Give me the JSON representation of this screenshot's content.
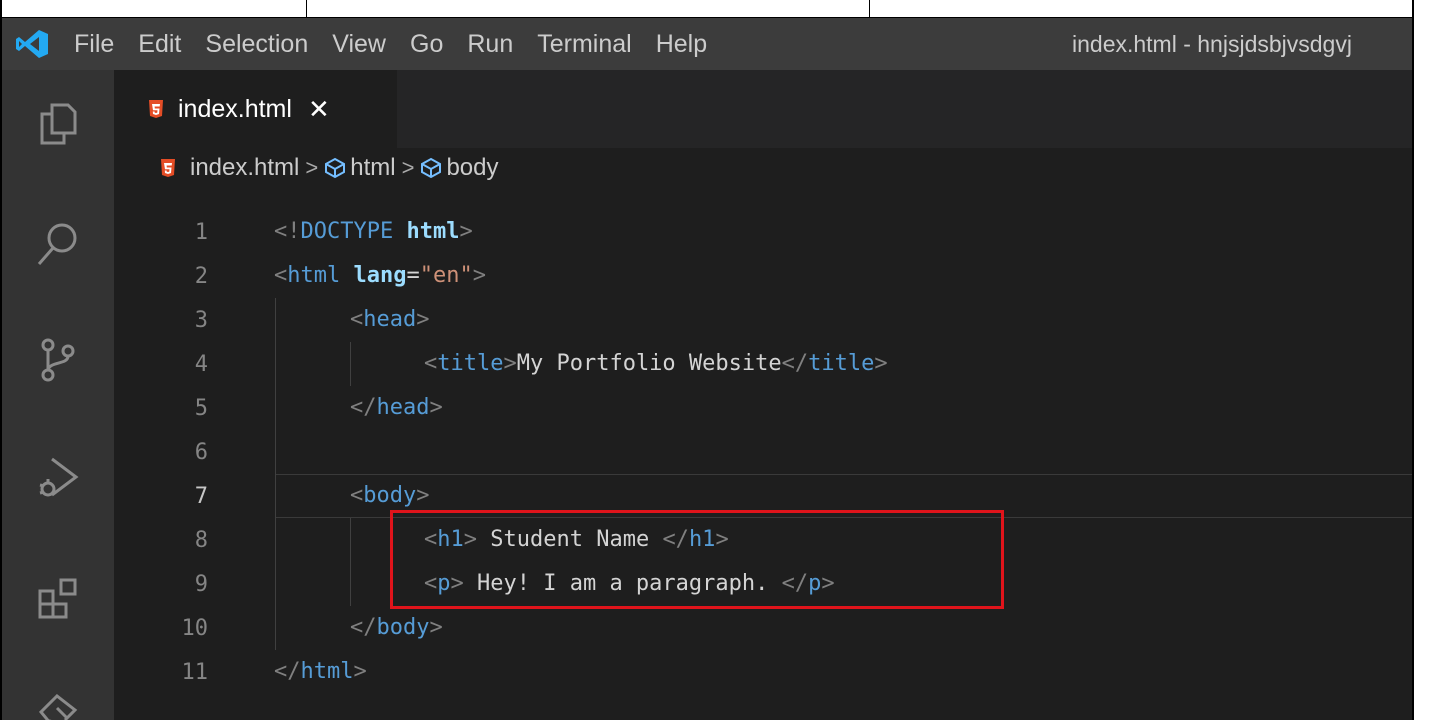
{
  "menu": [
    "File",
    "Edit",
    "Selection",
    "View",
    "Go",
    "Run",
    "Terminal",
    "Help"
  ],
  "window_title": "index.html - hnjsjdsbjvsdgvj",
  "activity_icons": [
    "explorer-icon",
    "search-icon",
    "source-control-icon",
    "run-debug-icon",
    "extensions-icon",
    "remote-explorer-icon"
  ],
  "tab": {
    "label": "index.html",
    "close": "✕"
  },
  "breadcrumb": {
    "file": "index.html",
    "sep": ">",
    "html": "html",
    "body": "body"
  },
  "code": {
    "line_numbers": [
      "1",
      "2",
      "3",
      "4",
      "5",
      "6",
      "7",
      "8",
      "9",
      "10",
      "11"
    ],
    "active_line": "7",
    "l1": {
      "open": "<!",
      "doctype": "DOCTYPE",
      "space": " ",
      "html": "html",
      "close": ">"
    },
    "l2": {
      "open": "<",
      "tag": "html",
      "space": " ",
      "attr": "lang",
      "eq": "=",
      "val": "\"en\"",
      "close": ">"
    },
    "l3": {
      "open": "<",
      "tag": "head",
      "close": ">"
    },
    "l4": {
      "open": "<",
      "tag": "title",
      "close": ">",
      "text": "My Portfolio Website",
      "open2": "</",
      "tag2": "title",
      "close2": ">"
    },
    "l5": {
      "open": "</",
      "tag": "head",
      "close": ">"
    },
    "l7": {
      "open": "<",
      "tag": "body",
      "close": ">"
    },
    "l8": {
      "open": "<",
      "tag": "h1",
      "close": ">",
      "text": " Student Name ",
      "open2": "</",
      "tag2": "h1",
      "close2": ">"
    },
    "l9": {
      "open": "<",
      "tag": "p",
      "close": ">",
      "text": " Hey! I am a paragraph. ",
      "open2": "</",
      "tag2": "p",
      "close2": ">"
    },
    "l10": {
      "open": "</",
      "tag": "body",
      "close": ">"
    },
    "l11": {
      "open": "</",
      "tag": "html",
      "close": ">"
    }
  },
  "colors": {
    "titlebar": "#3c3c3c",
    "activity_bar": "#333333",
    "editor_bg": "#1e1e1e",
    "html_icon": "#e44d26",
    "highlight_box": "#e0141b",
    "vscode_blue": "#23a9f2"
  }
}
